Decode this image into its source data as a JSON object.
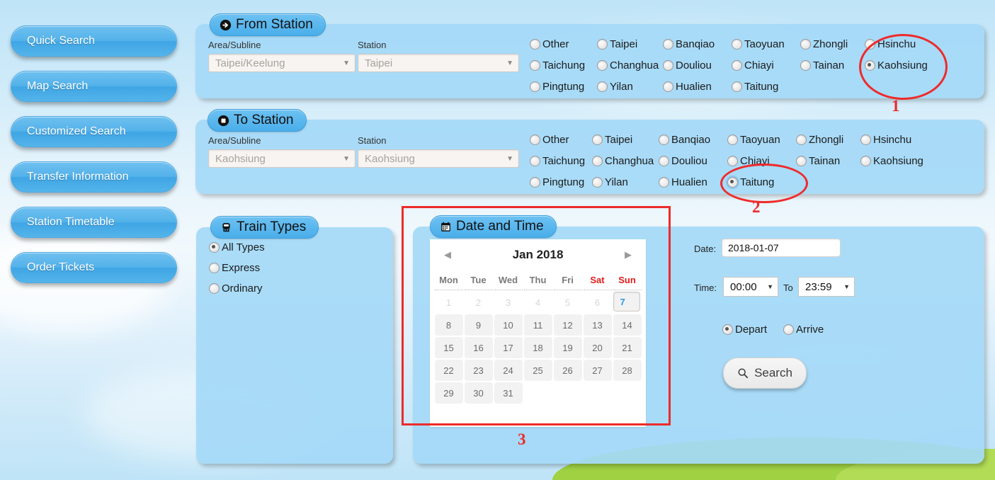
{
  "sidebar": {
    "items": [
      {
        "label": "Quick Search",
        "name": "quick-search"
      },
      {
        "label": "Map Search",
        "name": "map-search"
      },
      {
        "label": "Customized Search",
        "name": "customized-search"
      },
      {
        "label": "Transfer Information",
        "name": "transfer-information"
      },
      {
        "label": "Station Timetable",
        "name": "station-timetable"
      },
      {
        "label": "Order Tickets",
        "name": "order-tickets"
      }
    ]
  },
  "from_station": {
    "tag": "From Station",
    "icon": "arrow-circle-right-icon",
    "area_label": "Area/Subline",
    "area_value": "Taipei/Keelung",
    "station_label": "Station",
    "station_value": "Taipei",
    "stations": [
      {
        "label": "Other",
        "selected": false
      },
      {
        "label": "Taipei",
        "selected": false
      },
      {
        "label": "Banqiao",
        "selected": false
      },
      {
        "label": "Taoyuan",
        "selected": false
      },
      {
        "label": "Zhongli",
        "selected": false
      },
      {
        "label": "Hsinchu",
        "selected": false
      },
      {
        "label": "Taichung",
        "selected": false
      },
      {
        "label": "Changhua",
        "selected": false
      },
      {
        "label": "Douliou",
        "selected": false
      },
      {
        "label": "Chiayi",
        "selected": false
      },
      {
        "label": "Tainan",
        "selected": false
      },
      {
        "label": "Kaohsiung",
        "selected": true
      },
      {
        "label": "Pingtung",
        "selected": false
      },
      {
        "label": "Yilan",
        "selected": false
      },
      {
        "label": "Hualien",
        "selected": false
      },
      {
        "label": "Taitung",
        "selected": false
      }
    ]
  },
  "to_station": {
    "tag": "To Station",
    "icon": "stop-circle-icon",
    "area_label": "Area/Subline",
    "area_value": "Kaohsiung",
    "station_label": "Station",
    "station_value": "Kaohsiung",
    "stations": [
      {
        "label": "Other",
        "selected": false
      },
      {
        "label": "Taipei",
        "selected": false
      },
      {
        "label": "Banqiao",
        "selected": false
      },
      {
        "label": "Taoyuan",
        "selected": false
      },
      {
        "label": "Zhongli",
        "selected": false
      },
      {
        "label": "Hsinchu",
        "selected": false
      },
      {
        "label": "Taichung",
        "selected": false
      },
      {
        "label": "Changhua",
        "selected": false
      },
      {
        "label": "Douliou",
        "selected": false
      },
      {
        "label": "Chiayi",
        "selected": false
      },
      {
        "label": "Tainan",
        "selected": false
      },
      {
        "label": "Kaohsiung",
        "selected": false
      },
      {
        "label": "Pingtung",
        "selected": false
      },
      {
        "label": "Yilan",
        "selected": false
      },
      {
        "label": "Hualien",
        "selected": false
      },
      {
        "label": "Taitung",
        "selected": true
      }
    ]
  },
  "train_types": {
    "tag": "Train Types",
    "icon": "train-icon",
    "options": [
      {
        "label": "All Types",
        "selected": true
      },
      {
        "label": "Express",
        "selected": false
      },
      {
        "label": "Ordinary",
        "selected": false
      }
    ]
  },
  "date_time": {
    "tag": "Date and Time",
    "icon": "calendar-icon",
    "calendar": {
      "month_title": "Jan 2018",
      "prev_icon": "chevron-left-icon",
      "next_icon": "chevron-right-icon",
      "weekdays": [
        "Mon",
        "Tue",
        "Wed",
        "Thu",
        "Fri",
        "Sat",
        "Sun"
      ],
      "weekend_indices": [
        5,
        6
      ],
      "weeks": [
        [
          {
            "d": "1",
            "s": "old"
          },
          {
            "d": "2",
            "s": "old"
          },
          {
            "d": "3",
            "s": "old"
          },
          {
            "d": "4",
            "s": "old"
          },
          {
            "d": "5",
            "s": "old"
          },
          {
            "d": "6",
            "s": "old"
          },
          {
            "d": "7",
            "s": "sel"
          }
        ],
        [
          {
            "d": "8",
            "s": ""
          },
          {
            "d": "9",
            "s": ""
          },
          {
            "d": "10",
            "s": ""
          },
          {
            "d": "11",
            "s": ""
          },
          {
            "d": "12",
            "s": ""
          },
          {
            "d": "13",
            "s": ""
          },
          {
            "d": "14",
            "s": ""
          }
        ],
        [
          {
            "d": "15",
            "s": ""
          },
          {
            "d": "16",
            "s": ""
          },
          {
            "d": "17",
            "s": ""
          },
          {
            "d": "18",
            "s": ""
          },
          {
            "d": "19",
            "s": ""
          },
          {
            "d": "20",
            "s": ""
          },
          {
            "d": "21",
            "s": ""
          }
        ],
        [
          {
            "d": "22",
            "s": ""
          },
          {
            "d": "23",
            "s": ""
          },
          {
            "d": "24",
            "s": ""
          },
          {
            "d": "25",
            "s": ""
          },
          {
            "d": "26",
            "s": ""
          },
          {
            "d": "27",
            "s": ""
          },
          {
            "d": "28",
            "s": ""
          }
        ],
        [
          {
            "d": "29",
            "s": ""
          },
          {
            "d": "30",
            "s": ""
          },
          {
            "d": "31",
            "s": ""
          },
          {
            "d": "",
            "s": "empty"
          },
          {
            "d": "",
            "s": "empty"
          },
          {
            "d": "",
            "s": "empty"
          },
          {
            "d": "",
            "s": "empty"
          }
        ]
      ]
    }
  },
  "search_form": {
    "date_label": "Date:",
    "date_value": "2018-01-07",
    "time_label": "Time:",
    "time_from": "00:00",
    "time_to_label": "To",
    "time_to": "23:59",
    "depart_label": "Depart",
    "arrive_label": "Arrive",
    "depart_selected": true,
    "arrive_selected": false,
    "search_label": "Search",
    "search_icon": "magnifier-icon"
  },
  "annotations": [
    {
      "num": "1",
      "target": "from-station-kaohsiung-radio"
    },
    {
      "num": "2",
      "target": "to-station-taitung-radio"
    },
    {
      "num": "3",
      "target": "date-and-time-calendar"
    }
  ],
  "colors": {
    "accent": "#4aaeea",
    "panel": "#a4d9f7",
    "annotation": "#ee2b2b",
    "selected_day": "#2e9ae0",
    "weekend": "#e21b1b",
    "hill": "#9fd142"
  }
}
